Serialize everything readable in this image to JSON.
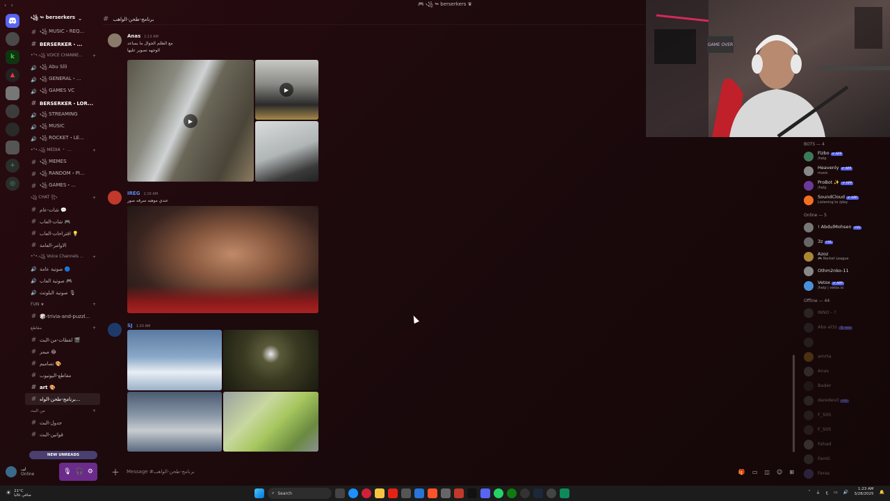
{
  "window": {
    "title": "🎮 ꧁ ↬ berserkers ♛",
    "nav": "‹ ›"
  },
  "server": {
    "name": "꧁ ↬ berserkers"
  },
  "channels": [
    {
      "type": "text",
      "label": "꧁ MUSIC・REQ..."
    },
    {
      "type": "text",
      "label": "BERSERKER・...",
      "bold": true
    },
    {
      "type": "category",
      "label": "•°•.꧁ VOICE CHANNE..."
    },
    {
      "type": "voice",
      "label": "꧁ Abu Slli"
    },
    {
      "type": "voice",
      "label": "꧁ GENERAL・..."
    },
    {
      "type": "voice",
      "label": "꧁ GAMES VC"
    },
    {
      "type": "text",
      "label": "BERSERKER・LOR...",
      "bold": true
    },
    {
      "type": "voice",
      "label": "꧁ STREAMING"
    },
    {
      "type": "voice",
      "label": "꧁ MUSIC"
    },
    {
      "type": "voice",
      "label": "꧁ ROCKET・LE..."
    },
    {
      "type": "category",
      "label": "•°•.꧁ MEDIA ・ ..."
    },
    {
      "type": "text",
      "label": "꧁ MEMES"
    },
    {
      "type": "text",
      "label": "꧁ RANDOM・PI..."
    },
    {
      "type": "text",
      "label": "꧁ GAMES・..."
    },
    {
      "type": "category",
      "label": "꧁ CHAT ꧂"
    },
    {
      "type": "text",
      "label": "شات-عام 💬"
    },
    {
      "type": "text",
      "label": "شات-العاب 🎮"
    },
    {
      "type": "text",
      "label": "اقتراحات-العاب 💡"
    },
    {
      "type": "text",
      "label": "الاوامر-العامة"
    },
    {
      "type": "category",
      "label": "•°•.꧁ Voice Channels ..."
    },
    {
      "type": "voice",
      "label": "صوتية عامة 🔵"
    },
    {
      "type": "voice",
      "label": "صوتية العاب 🎮"
    },
    {
      "type": "voice",
      "label": "صوتية البلوتث 🎙"
    },
    {
      "type": "category",
      "label": "FUN ★"
    },
    {
      "type": "text",
      "label": "🎲-trivia-and-puzzl..."
    },
    {
      "type": "category",
      "label": "مقاطع"
    },
    {
      "type": "text",
      "label": "لقطات-من-البث 🎬"
    },
    {
      "type": "text",
      "label": "ميمز 😂"
    },
    {
      "type": "text",
      "label": "تصاميم 🎨"
    },
    {
      "type": "text",
      "label": "مقاطع-اليوتيوب"
    },
    {
      "type": "text",
      "label": "art 🎨",
      "bold": true
    },
    {
      "type": "text",
      "label": "برنامج-طحن-الواه...",
      "active": true
    },
    {
      "type": "category",
      "label": "من البث"
    },
    {
      "type": "text",
      "label": "جدول-البث"
    },
    {
      "type": "text",
      "label": "قوانين-البث"
    }
  ],
  "new_unreads": "NEW UNREADS",
  "user": {
    "name": "ليــ",
    "status": "Online"
  },
  "chat": {
    "channel": "برنامج-طحن-الواهب",
    "composer_placeholder": "Message #برنامج-طحن-الواهب"
  },
  "messages": [
    {
      "author": "Anas",
      "time": "1:13 AM",
      "lines": [
        "مع الظلم الجوال ما يساعد",
        "الوجهه تصوير عليها"
      ],
      "author_color": "#eeeeee"
    },
    {
      "author": "IREG",
      "time": "1:16 AM",
      "lines": [
        "عندي موهبه سرقه صور"
      ],
      "author_color": "#5b8dee"
    },
    {
      "author": "SJ",
      "time": "1:20 AM",
      "lines": [],
      "author_color": "#5b8dee"
    }
  ],
  "members": {
    "groups": [
      {
        "label": "BOTS — 4",
        "items": [
          {
            "name": "Fizbo",
            "status": "/help",
            "badge": "✔ APP",
            "color": "#3b7b5a"
          },
          {
            "name": "Heavenly",
            "status": "music",
            "badge": "✔ APP",
            "color": "#888888"
          },
          {
            "name": "ProBot ✨",
            "status": "/help",
            "badge": "✔ APP",
            "color": "#6a3a9a"
          },
          {
            "name": "SoundCloud",
            "status": "Listening to /play",
            "badge": "✔ APP",
            "color": "#f26f23"
          }
        ]
      },
      {
        "label": "Online — 5",
        "items": [
          {
            "name": "! AbdulMohsen",
            "status": "",
            "badge": "⚡VL",
            "color": "#777777"
          },
          {
            "name": "3z",
            "status": "",
            "badge": "⚡VL",
            "color": "#666666"
          },
          {
            "name": "Azoz",
            "status": "🎮 Rocket League",
            "badge": "",
            "color": "#aa8833"
          },
          {
            "name": "Othm2nko-11",
            "status": "",
            "badge": "",
            "color": "#888888"
          },
          {
            "name": "Vetox",
            "status": "/help | vetox.io",
            "badge": "✔ APP",
            "color": "#4a90d9"
          }
        ]
      },
      {
        "label": "Offline — 44",
        "items": [
          {
            "name": "INNO - ?",
            "status": "",
            "badge": "",
            "color": "#555555",
            "off": true
          },
          {
            "name": "Abo al3z",
            "status": "",
            "badge": "🎙 app",
            "color": "#444444",
            "off": true
          },
          {
            "name": "",
            "status": "",
            "badge": "",
            "color": "#444444",
            "off": true
          },
          {
            "name": "amrta",
            "status": "",
            "badge": "",
            "color": "#aa7722",
            "off": true
          },
          {
            "name": "Anas",
            "status": "",
            "badge": "",
            "color": "#666666",
            "off": true
          },
          {
            "name": "Bader",
            "status": "",
            "badge": "",
            "color": "#333333",
            "off": true
          },
          {
            "name": "daredevil",
            "status": "",
            "badge": "⚡VL",
            "color": "#555555",
            "off": true
          },
          {
            "name": "F_505",
            "status": "",
            "badge": "",
            "color": "#444444",
            "off": true
          },
          {
            "name": "F_505",
            "status": "",
            "badge": "",
            "color": "#444444",
            "off": true
          },
          {
            "name": "Fahad",
            "status": "",
            "badge": "",
            "color": "#777777",
            "off": true
          },
          {
            "name": "Famti",
            "status": "",
            "badge": "",
            "color": "#555555",
            "off": true
          },
          {
            "name": "Feras",
            "status": "",
            "badge": "",
            "color": "#555599",
            "off": true
          }
        ]
      }
    ]
  },
  "webcam": {
    "sign": "GAME OVER"
  },
  "taskbar": {
    "weather_temp": "21°C",
    "weather_desc": "صافي غالبا",
    "search": "Search",
    "time": "1:23 AM",
    "date": "3/28/2025"
  },
  "colors": {
    "accent": "#5865f2",
    "bg": "#1d0a0d",
    "user_controls": "#6b2b8a"
  }
}
